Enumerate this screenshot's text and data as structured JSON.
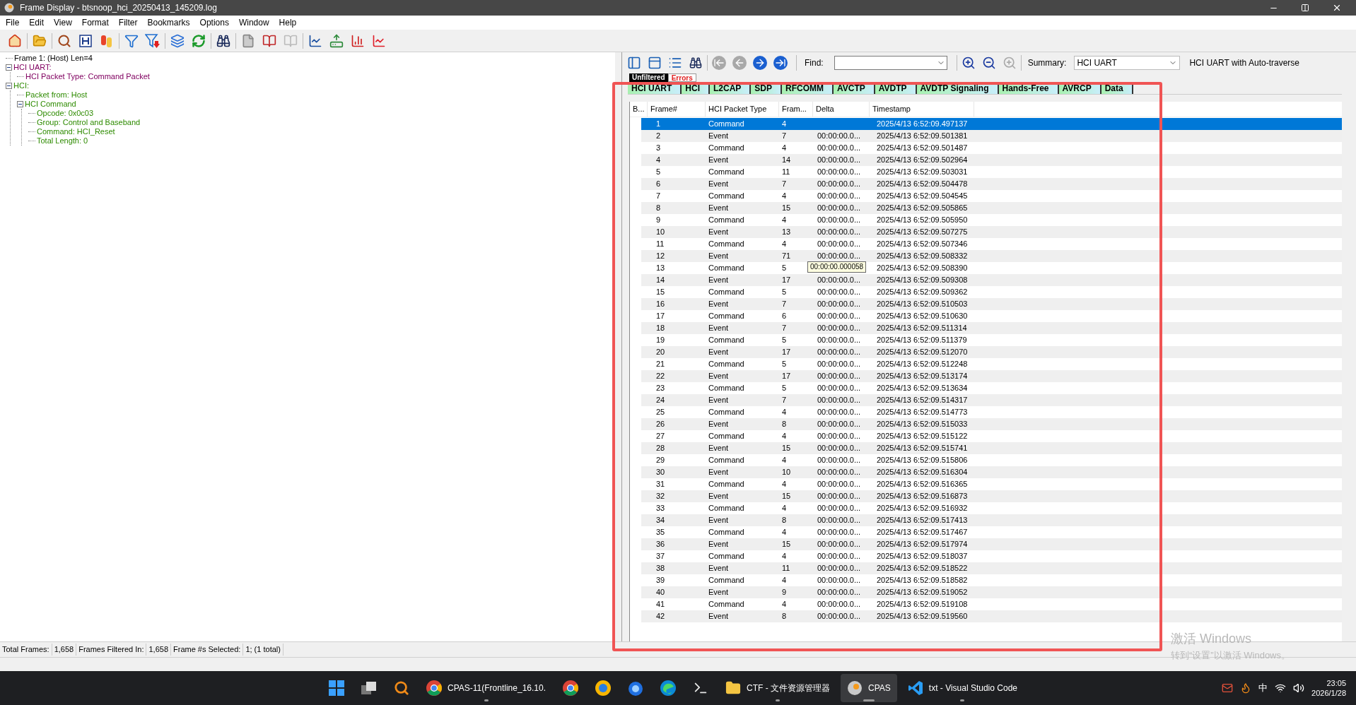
{
  "window": {
    "title": "Frame Display - btsnoop_hci_20250413_145209.log"
  },
  "menu": [
    "File",
    "Edit",
    "View",
    "Format",
    "Filter",
    "Bookmarks",
    "Options",
    "Window",
    "Help"
  ],
  "tree": [
    {
      "label": "Frame 1: (Host) Len=4",
      "color": "#000000"
    },
    {
      "label": "HCI UART:",
      "color": "#800060",
      "expanded": true,
      "children": [
        {
          "label": "HCI Packet Type: Command Packet",
          "color": "#800060"
        }
      ]
    },
    {
      "label": "HCI:",
      "color": "#2e8b00",
      "expanded": true,
      "children": [
        {
          "label": "Packet from: Host",
          "color": "#2e8b00"
        },
        {
          "label": "HCI Command",
          "color": "#2e8b00",
          "expanded": true,
          "children": [
            {
              "label": "Opcode: 0x0c03",
              "color": "#2e8b00"
            },
            {
              "label": "Group: Control and Baseband",
              "color": "#2e8b00"
            },
            {
              "label": "Command: HCI_Reset",
              "color": "#2e8b00"
            },
            {
              "label": "Total Length: 0",
              "color": "#2e8b00"
            }
          ]
        }
      ]
    }
  ],
  "find": {
    "label": "Find:"
  },
  "summary": {
    "label": "Summary:",
    "value": "HCI UART",
    "note": "HCI UART with Auto-traverse"
  },
  "view_tabs": [
    {
      "label": "Unfiltered",
      "selected": true
    },
    {
      "label": "Errors",
      "selected": false
    }
  ],
  "protocol_tabs": [
    "HCI UART",
    "HCI",
    "L2CAP",
    "SDP",
    "RFCOMM",
    "AVCTP",
    "AVDTP",
    "AVDTP Signaling",
    "Hands-Free",
    "AVRCP",
    "Data"
  ],
  "table": {
    "columns": [
      "B...",
      "Frame#",
      "HCI Packet Type",
      "Fram...",
      "Delta",
      "Timestamp"
    ],
    "rows": [
      {
        "frame": "1",
        "type": "Command",
        "len": "4",
        "ts": "2025/4/13 6:52:09.497137",
        "selected": true
      },
      {
        "frame": "2",
        "type": "Event",
        "len": "7",
        "delta": "00:00:00.0...",
        "ts": "2025/4/13 6:52:09.501381",
        "selected": false
      },
      {
        "frame": "3",
        "type": "Command",
        "len": "4",
        "delta": "00:00:00.0...",
        "ts": "2025/4/13 6:52:09.501487",
        "selected": false
      },
      {
        "frame": "4",
        "type": "Event",
        "len": "14",
        "delta": "00:00:00.0...",
        "ts": "2025/4/13 6:52:09.502964",
        "selected": false
      },
      {
        "frame": "5",
        "type": "Command",
        "len": "11",
        "delta": "00:00:00.0...",
        "ts": "2025/4/13 6:52:09.503031",
        "selected": false
      },
      {
        "frame": "6",
        "type": "Event",
        "len": "7",
        "delta": "00:00:00.0...",
        "ts": "2025/4/13 6:52:09.504478",
        "selected": false
      },
      {
        "frame": "7",
        "type": "Command",
        "len": "4",
        "delta": "00:00:00.0...",
        "ts": "2025/4/13 6:52:09.504545",
        "selected": false
      },
      {
        "frame": "8",
        "type": "Event",
        "len": "15",
        "delta": "00:00:00.0...",
        "ts": "2025/4/13 6:52:09.505865",
        "selected": false
      },
      {
        "frame": "9",
        "type": "Command",
        "len": "4",
        "delta": "00:00:00.0...",
        "ts": "2025/4/13 6:52:09.505950",
        "selected": false
      },
      {
        "frame": "10",
        "type": "Event",
        "len": "13",
        "delta": "00:00:00.0...",
        "ts": "2025/4/13 6:52:09.507275",
        "selected": false
      },
      {
        "frame": "11",
        "type": "Command",
        "len": "4",
        "delta": "00:00:00.0...",
        "ts": "2025/4/13 6:52:09.507346",
        "selected": false
      },
      {
        "frame": "12",
        "type": "Event",
        "len": "71",
        "delta": "00:00:00.0...",
        "ts": "2025/4/13 6:52:09.508332",
        "selected": false
      },
      {
        "frame": "13",
        "type": "Command",
        "len": "5",
        "delta": "00:00:00.000058",
        "hover": true,
        "ts": "2025/4/13 6:52:09.508390",
        "selected": false
      },
      {
        "frame": "14",
        "type": "Event",
        "len": "17",
        "delta": "00:00:00.0...",
        "ts": "2025/4/13 6:52:09.509308",
        "selected": false
      },
      {
        "frame": "15",
        "type": "Command",
        "len": "5",
        "delta": "00:00:00.0...",
        "ts": "2025/4/13 6:52:09.509362",
        "selected": false
      },
      {
        "frame": "16",
        "type": "Event",
        "len": "7",
        "delta": "00:00:00.0...",
        "ts": "2025/4/13 6:52:09.510503",
        "selected": false
      },
      {
        "frame": "17",
        "type": "Command",
        "len": "6",
        "delta": "00:00:00.0...",
        "ts": "2025/4/13 6:52:09.510630",
        "selected": false
      },
      {
        "frame": "18",
        "type": "Event",
        "len": "7",
        "delta": "00:00:00.0...",
        "ts": "2025/4/13 6:52:09.511314",
        "selected": false
      },
      {
        "frame": "19",
        "type": "Command",
        "len": "5",
        "delta": "00:00:00.0...",
        "ts": "2025/4/13 6:52:09.511379",
        "selected": false
      },
      {
        "frame": "20",
        "type": "Event",
        "len": "17",
        "delta": "00:00:00.0...",
        "ts": "2025/4/13 6:52:09.512070",
        "selected": false
      },
      {
        "frame": "21",
        "type": "Command",
        "len": "5",
        "delta": "00:00:00.0...",
        "ts": "2025/4/13 6:52:09.512248",
        "selected": false
      },
      {
        "frame": "22",
        "type": "Event",
        "len": "17",
        "delta": "00:00:00.0...",
        "ts": "2025/4/13 6:52:09.513174",
        "selected": false
      },
      {
        "frame": "23",
        "type": "Command",
        "len": "5",
        "delta": "00:00:00.0...",
        "ts": "2025/4/13 6:52:09.513634",
        "selected": false
      },
      {
        "frame": "24",
        "type": "Event",
        "len": "7",
        "delta": "00:00:00.0...",
        "ts": "2025/4/13 6:52:09.514317",
        "selected": false
      },
      {
        "frame": "25",
        "type": "Command",
        "len": "4",
        "delta": "00:00:00.0...",
        "ts": "2025/4/13 6:52:09.514773",
        "selected": false
      },
      {
        "frame": "26",
        "type": "Event",
        "len": "8",
        "delta": "00:00:00.0...",
        "ts": "2025/4/13 6:52:09.515033",
        "selected": false
      },
      {
        "frame": "27",
        "type": "Command",
        "len": "4",
        "delta": "00:00:00.0...",
        "ts": "2025/4/13 6:52:09.515122",
        "selected": false
      },
      {
        "frame": "28",
        "type": "Event",
        "len": "15",
        "delta": "00:00:00.0...",
        "ts": "2025/4/13 6:52:09.515741",
        "selected": false
      },
      {
        "frame": "29",
        "type": "Command",
        "len": "4",
        "delta": "00:00:00.0...",
        "ts": "2025/4/13 6:52:09.515806",
        "selected": false
      },
      {
        "frame": "30",
        "type": "Event",
        "len": "10",
        "delta": "00:00:00.0...",
        "ts": "2025/4/13 6:52:09.516304",
        "selected": false
      },
      {
        "frame": "31",
        "type": "Command",
        "len": "4",
        "delta": "00:00:00.0...",
        "ts": "2025/4/13 6:52:09.516365",
        "selected": false
      },
      {
        "frame": "32",
        "type": "Event",
        "len": "15",
        "delta": "00:00:00.0...",
        "ts": "2025/4/13 6:52:09.516873",
        "selected": false
      },
      {
        "frame": "33",
        "type": "Command",
        "len": "4",
        "delta": "00:00:00.0...",
        "ts": "2025/4/13 6:52:09.516932",
        "selected": false
      },
      {
        "frame": "34",
        "type": "Event",
        "len": "8",
        "delta": "00:00:00.0...",
        "ts": "2025/4/13 6:52:09.517413",
        "selected": false
      },
      {
        "frame": "35",
        "type": "Command",
        "len": "4",
        "delta": "00:00:00.0...",
        "ts": "2025/4/13 6:52:09.517467",
        "selected": false
      },
      {
        "frame": "36",
        "type": "Event",
        "len": "15",
        "delta": "00:00:00.0...",
        "ts": "2025/4/13 6:52:09.517974",
        "selected": false
      },
      {
        "frame": "37",
        "type": "Command",
        "len": "4",
        "delta": "00:00:00.0...",
        "ts": "2025/4/13 6:52:09.518037",
        "selected": false
      },
      {
        "frame": "38",
        "type": "Event",
        "len": "11",
        "delta": "00:00:00.0...",
        "ts": "2025/4/13 6:52:09.518522",
        "selected": false
      },
      {
        "frame": "39",
        "type": "Command",
        "len": "4",
        "delta": "00:00:00.0...",
        "ts": "2025/4/13 6:52:09.518582",
        "selected": false
      },
      {
        "frame": "40",
        "type": "Event",
        "len": "9",
        "delta": "00:00:00.0...",
        "ts": "2025/4/13 6:52:09.519052",
        "selected": false
      },
      {
        "frame": "41",
        "type": "Command",
        "len": "4",
        "delta": "00:00:00.0...",
        "ts": "2025/4/13 6:52:09.519108",
        "selected": false
      },
      {
        "frame": "42",
        "type": "Event",
        "len": "8",
        "delta": "00:00:00.0...",
        "ts": "2025/4/13 6:52:09.519560",
        "selected": false
      }
    ]
  },
  "status_bar": [
    "Total Frames:",
    "1,658",
    "Frames Filtered In:",
    "1,658",
    "Frame #s Selected:",
    "1; (1 total)"
  ],
  "activation_notice": {
    "title": "激活 Windows",
    "text": "转到“设置”以激活 Windows。"
  },
  "taskbar": {
    "apps": [
      {
        "kind": "start"
      },
      {
        "kind": "taskview"
      },
      {
        "kind": "search"
      },
      {
        "kind": "chrome",
        "label": "CPAS-11(Frontline_16.10.",
        "running": true,
        "active": false
      },
      {
        "kind": "chrome"
      },
      {
        "kind": "foxyellow"
      },
      {
        "kind": "firefox"
      },
      {
        "kind": "edge"
      },
      {
        "kind": "terminal"
      },
      {
        "kind": "folder",
        "label": "CTF - 文件资源管理器",
        "running": true,
        "active": false
      },
      {
        "kind": "cpas",
        "label": "CPAS",
        "running": true,
        "active": true
      },
      {
        "kind": "vscode",
        "label": "txt - Visual Studio Code",
        "running": true,
        "active": false
      }
    ],
    "tray": {
      "ime": "中",
      "time": "23:05",
      "date": "2026/1/28"
    }
  }
}
